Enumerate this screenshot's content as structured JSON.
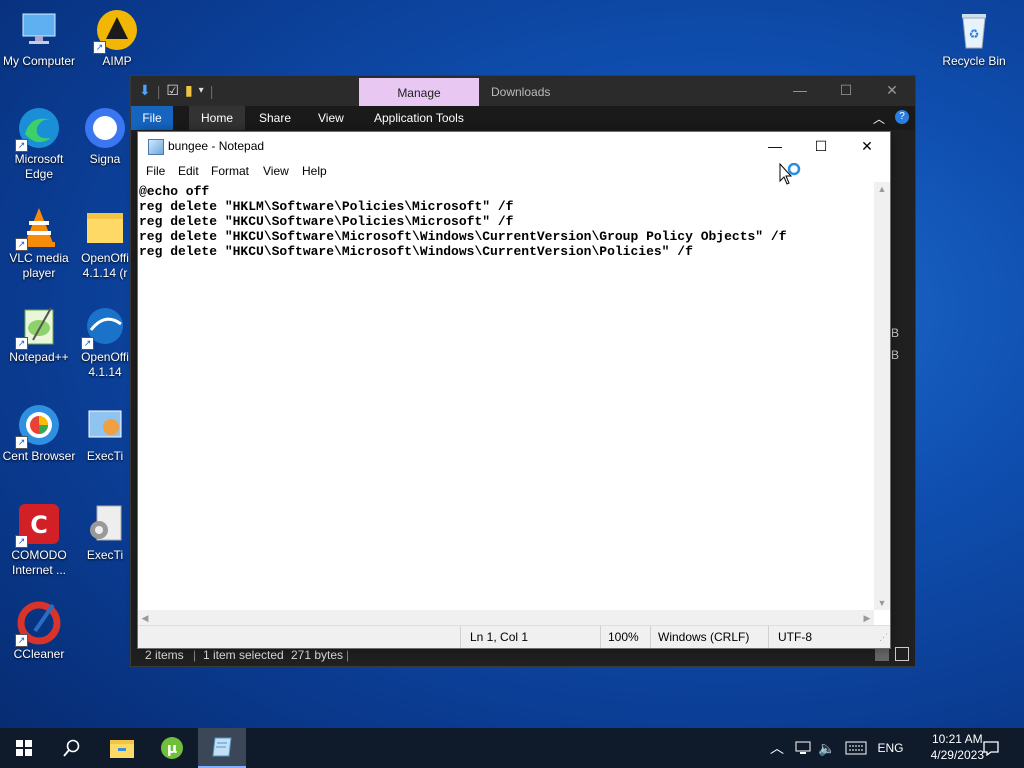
{
  "desktop": {
    "icons": [
      {
        "label": "My Computer"
      },
      {
        "label": "AIMP"
      },
      {
        "label": "Recycle Bin"
      },
      {
        "label": "Microsoft Edge"
      },
      {
        "label": "Signa"
      },
      {
        "label": "VLC media player"
      },
      {
        "label": "OpenOffi 4.1.14 (r"
      },
      {
        "label": "Notepad++"
      },
      {
        "label": "OpenOffi 4.1.14"
      },
      {
        "label": "Cent Browser"
      },
      {
        "label": "ExecTi"
      },
      {
        "label": "COMODO Internet ..."
      },
      {
        "label": "ExecTi"
      },
      {
        "label": "CCleaner"
      }
    ]
  },
  "explorer": {
    "tab_manage": "Manage",
    "tab_downloads": "Downloads",
    "ribbon_tabs": [
      "File",
      "Home",
      "Share",
      "View",
      "Application Tools"
    ],
    "status": {
      "items": "2 items",
      "selected": "1 item selected",
      "size": "271 bytes"
    },
    "side_fragments": [
      "B",
      "B"
    ]
  },
  "notepad": {
    "title": "bungee - Notepad",
    "menu": [
      "File",
      "Edit",
      "Format",
      "View",
      "Help"
    ],
    "content": "@echo off\nreg delete \"HKLM\\Software\\Policies\\Microsoft\" /f\nreg delete \"HKCU\\Software\\Policies\\Microsoft\" /f\nreg delete \"HKCU\\Software\\Microsoft\\Windows\\CurrentVersion\\Group Policy Objects\" /f\nreg delete \"HKCU\\Software\\Microsoft\\Windows\\CurrentVersion\\Policies\" /f",
    "status": {
      "position": "Ln 1, Col 1",
      "zoom": "100%",
      "line_ending": "Windows (CRLF)",
      "encoding": "UTF-8"
    }
  },
  "taskbar": {
    "language": "ENG",
    "time": "10:21 AM",
    "date": "4/29/2023"
  }
}
